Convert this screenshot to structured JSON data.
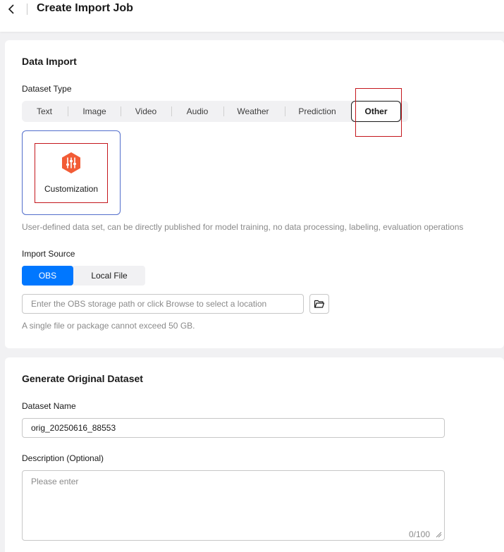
{
  "header": {
    "title": "Create Import Job",
    "back_icon": "chevron-left-icon"
  },
  "data_import": {
    "title": "Data Import",
    "dataset_type_label": "Dataset Type",
    "tabs": [
      {
        "label": "Text",
        "active": false
      },
      {
        "label": "Image",
        "active": false
      },
      {
        "label": "Video",
        "active": false
      },
      {
        "label": "Audio",
        "active": false
      },
      {
        "label": "Weather",
        "active": false
      },
      {
        "label": "Prediction",
        "active": false
      },
      {
        "label": "Other",
        "active": true
      }
    ],
    "type_card": {
      "label": "Customization",
      "icon": "sliders-hexagon-icon",
      "icon_color": "#f25c36",
      "description": "User-defined data set, can be directly published for model training, no data processing, labeling, evaluation operations"
    },
    "import_source_label": "Import Source",
    "sources": [
      {
        "label": "OBS",
        "active": true
      },
      {
        "label": "Local File",
        "active": false
      }
    ],
    "path_input": {
      "value": "",
      "placeholder": "Enter the OBS storage path or click Browse to select a location"
    },
    "browse_icon": "folder-open-icon",
    "size_hint": "A single file or package cannot exceed 50 GB."
  },
  "generate_dataset": {
    "title": "Generate Original Dataset",
    "name_label": "Dataset Name",
    "name_value": "orig_20250616_88553",
    "description_label": "Description (Optional)",
    "description_value": "",
    "description_placeholder": "Please enter",
    "char_count": "0/100"
  },
  "colors": {
    "primary": "#0077ff",
    "selected_border": "#526ecc",
    "highlight": "#c4161c",
    "page_bg": "#f1f1f3"
  }
}
